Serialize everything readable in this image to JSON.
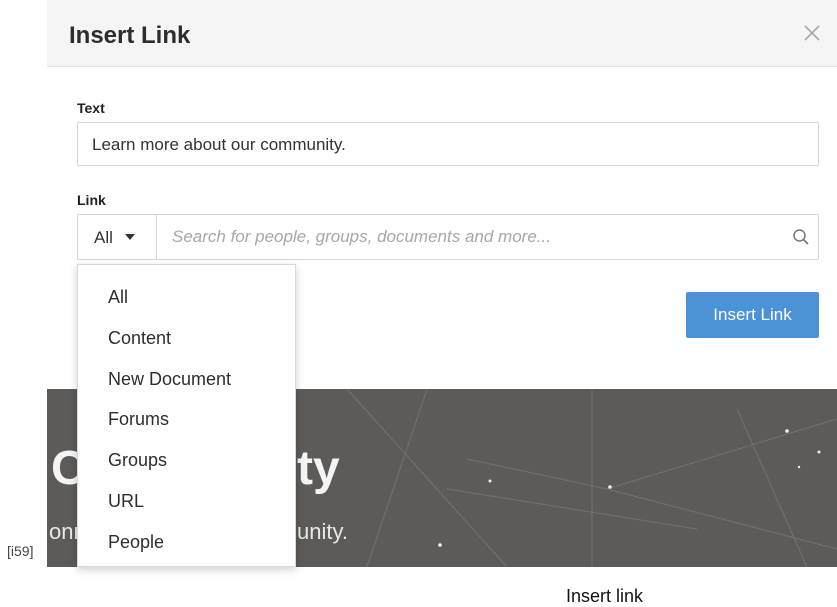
{
  "modal": {
    "title": "Insert Link",
    "text_label": "Text",
    "text_value": "Learn more about our community.",
    "link_label": "Link",
    "link_type_selected": "All",
    "search_placeholder": "Search for people, groups, documents and more...",
    "insert_button": "Insert Link",
    "icons": {
      "close": "close-icon",
      "search": "search-icon",
      "caret": "chevron-down-icon"
    }
  },
  "dropdown": {
    "options": [
      "All",
      "Content",
      "New Document",
      "Forums",
      "Groups",
      "URL",
      "People"
    ]
  },
  "background": {
    "title_start": "C",
    "title_end": "ty",
    "subtitle_start": "onn",
    "subtitle_end": "unity."
  },
  "ref_tag": "[i59]",
  "caption": "Insert link",
  "colors": {
    "primary": "#4b92d6",
    "header_bg": "#f5f5f5",
    "banner_bg": "#5d5a58"
  }
}
